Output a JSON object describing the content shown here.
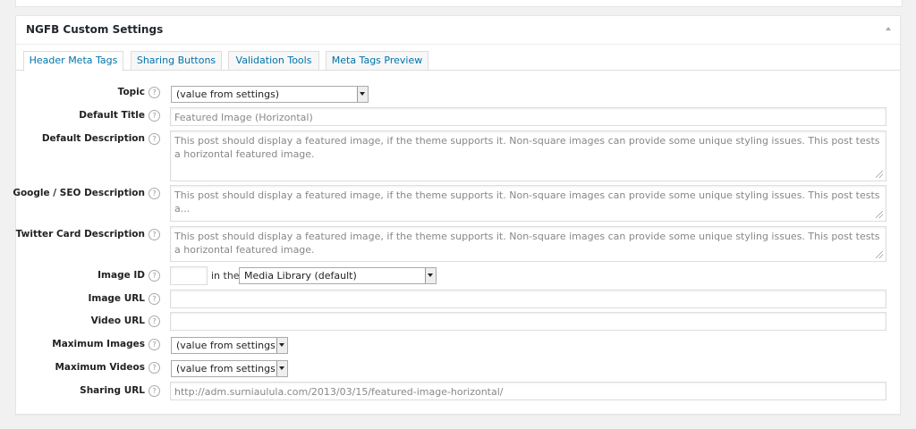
{
  "metabox": {
    "title": "NGFB Custom Settings",
    "tabs": [
      {
        "label": "Header Meta Tags",
        "active": true
      },
      {
        "label": "Sharing Buttons",
        "active": false
      },
      {
        "label": "Validation Tools",
        "active": false
      },
      {
        "label": "Meta Tags Preview",
        "active": false
      }
    ]
  },
  "help_glyph": "?",
  "fields": {
    "topic": {
      "label": "Topic",
      "value": "(value from settings)"
    },
    "default_title": {
      "label": "Default Title",
      "placeholder": "Featured Image (Horizontal)"
    },
    "default_description": {
      "label": "Default Description",
      "placeholder": "This post should display a featured image, if the theme supports it. Non-square images can provide some unique styling issues. This post tests a horizontal featured image."
    },
    "seo_description": {
      "label": "Google / SEO Description",
      "placeholder": "This post should display a featured image, if the theme supports it. Non-square images can provide some unique styling issues. This post tests a..."
    },
    "twitter_description": {
      "label": "Twitter Card Description",
      "placeholder": "This post should display a featured image, if the theme supports it. Non-square images can provide some unique styling issues. This post tests a horizontal featured image."
    },
    "image_id": {
      "label": "Image ID",
      "value": "",
      "in_the": "in the",
      "library": "Media Library (default)"
    },
    "image_url": {
      "label": "Image URL",
      "value": ""
    },
    "video_url": {
      "label": "Video URL",
      "value": ""
    },
    "max_images": {
      "label": "Maximum Images",
      "value": "(value from settings)"
    },
    "max_videos": {
      "label": "Maximum Videos",
      "value": "(value from settings)"
    },
    "sharing_url": {
      "label": "Sharing URL",
      "placeholder": "http://adm.surniaulula.com/2013/03/15/featured-image-horizontal/"
    }
  }
}
